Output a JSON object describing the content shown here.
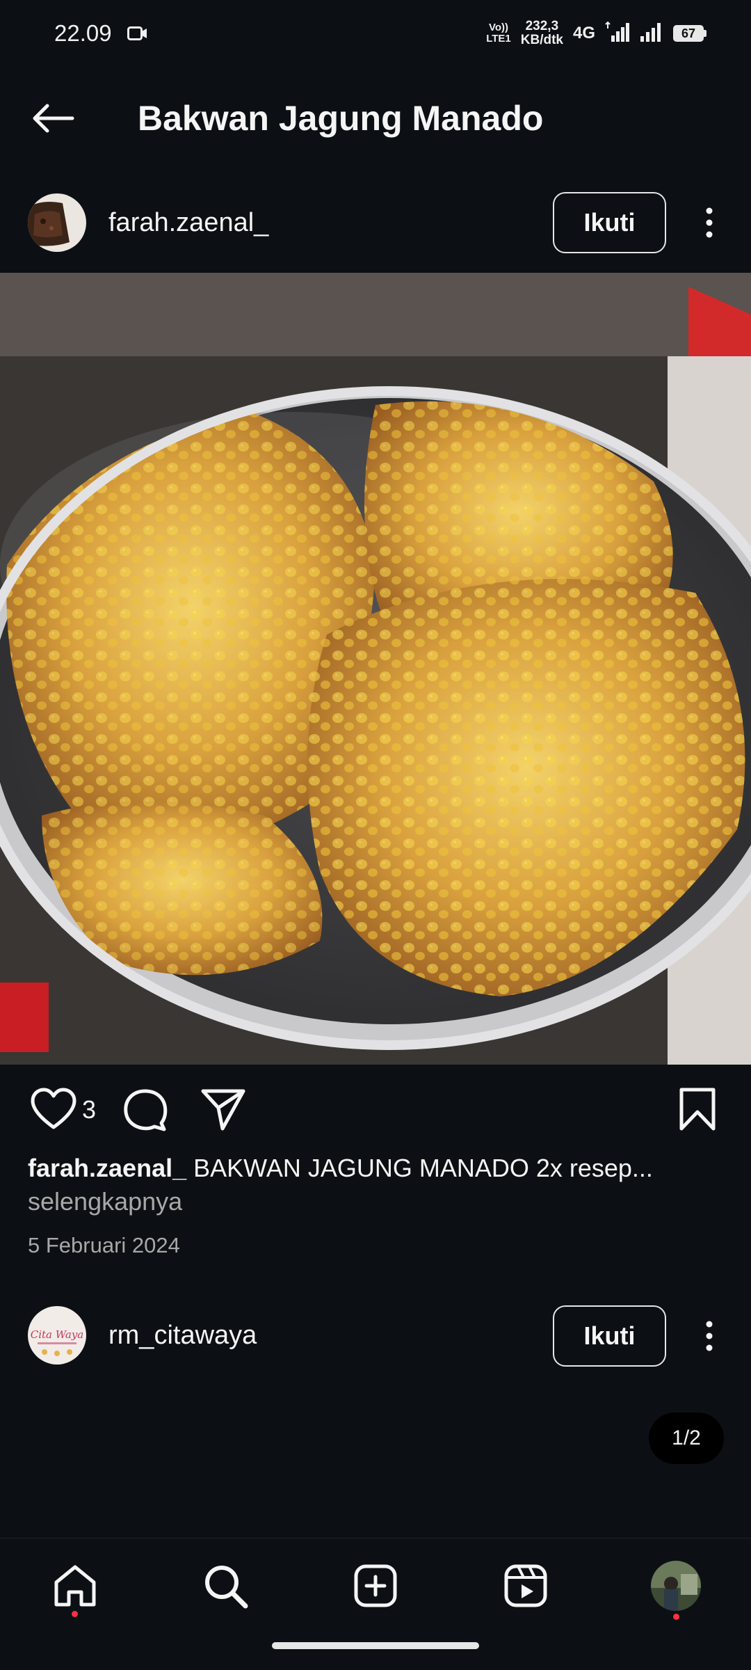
{
  "status_bar": {
    "time": "22.09",
    "volte_top": "Vo))",
    "volte_bottom": "LTE1",
    "speed_value": "232,3",
    "speed_unit": "KB/dtk",
    "network": "4G",
    "battery": "67"
  },
  "header": {
    "title": "Bakwan Jagung Manado"
  },
  "post": {
    "username": "farah.zaenal_",
    "follow_label": "Ikuti",
    "likes": "3",
    "caption_user": "farah.zaenal_",
    "caption_text": "BAKWAN JAGUNG MANADO 2x resep...",
    "more_label": "selengkapnya",
    "date": "5 Februari 2024"
  },
  "next_post": {
    "username": "rm_citawaya",
    "avatar_text": "Cita Waya",
    "follow_label": "Ikuti",
    "page_indicator": "1/2"
  },
  "nav": {
    "items": [
      "home-icon",
      "search-icon",
      "create-icon",
      "reels-icon",
      "profile-avatar"
    ]
  },
  "colors": {
    "background": "#0c1014",
    "text": "#f5f5f5",
    "secondary_text": "#a8a8a8",
    "notification": "#ff3040"
  }
}
